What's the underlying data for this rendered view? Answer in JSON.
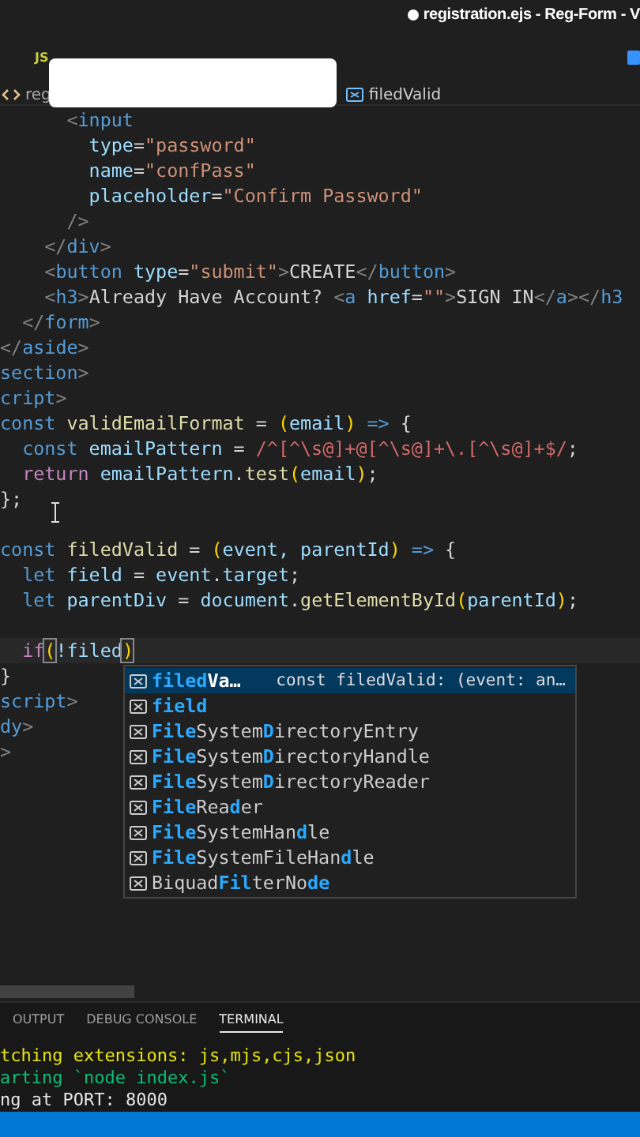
{
  "window": {
    "title": "registration.ejs - Reg-Form - V",
    "unsaved": true
  },
  "tab_bar": {
    "file_icon": "JS"
  },
  "breadcrumb": {
    "start": "reg",
    "symbol": "filedValid"
  },
  "editor": {
    "lines": [
      {
        "tokens": [
          {
            "text": "      <",
            "kind": "p"
          },
          {
            "text": "input",
            "kind": "tag"
          }
        ]
      },
      {
        "tokens": [
          {
            "text": "        type",
            "kind": "attr"
          },
          {
            "text": "=",
            "kind": "txt"
          },
          {
            "text": "\"password\"",
            "kind": "str"
          }
        ]
      },
      {
        "tokens": [
          {
            "text": "        name",
            "kind": "attr"
          },
          {
            "text": "=",
            "kind": "txt"
          },
          {
            "text": "\"confPass\"",
            "kind": "str"
          }
        ]
      },
      {
        "tokens": [
          {
            "text": "        placeholder",
            "kind": "attr"
          },
          {
            "text": "=",
            "kind": "txt"
          },
          {
            "text": "\"Confirm Password\"",
            "kind": "str"
          }
        ]
      },
      {
        "tokens": [
          {
            "text": "      />",
            "kind": "p"
          }
        ]
      },
      {
        "tokens": [
          {
            "text": "    </",
            "kind": "p"
          },
          {
            "text": "div",
            "kind": "tag"
          },
          {
            "text": ">",
            "kind": "p"
          }
        ]
      },
      {
        "tokens": [
          {
            "text": "    <",
            "kind": "p"
          },
          {
            "text": "button",
            "kind": "tag"
          },
          {
            "text": " type",
            "kind": "attr"
          },
          {
            "text": "=",
            "kind": "txt"
          },
          {
            "text": "\"submit\"",
            "kind": "str"
          },
          {
            "text": ">",
            "kind": "p"
          },
          {
            "text": "CREATE",
            "kind": "txt"
          },
          {
            "text": "</",
            "kind": "p"
          },
          {
            "text": "button",
            "kind": "tag"
          },
          {
            "text": ">",
            "kind": "p"
          }
        ]
      },
      {
        "tokens": [
          {
            "text": "    <",
            "kind": "p"
          },
          {
            "text": "h3",
            "kind": "tag"
          },
          {
            "text": ">",
            "kind": "p"
          },
          {
            "text": "Already Have Account? ",
            "kind": "txt"
          },
          {
            "text": "<",
            "kind": "p"
          },
          {
            "text": "a",
            "kind": "tag"
          },
          {
            "text": " href",
            "kind": "attr"
          },
          {
            "text": "=",
            "kind": "txt"
          },
          {
            "text": "\"\"",
            "kind": "str"
          },
          {
            "text": ">",
            "kind": "p"
          },
          {
            "text": "SIGN IN",
            "kind": "txt"
          },
          {
            "text": "</",
            "kind": "p"
          },
          {
            "text": "a",
            "kind": "tag"
          },
          {
            "text": "></",
            "kind": "p"
          },
          {
            "text": "h3",
            "kind": "tag"
          }
        ]
      },
      {
        "tokens": [
          {
            "text": "  </",
            "kind": "p"
          },
          {
            "text": "form",
            "kind": "tag"
          },
          {
            "text": ">",
            "kind": "p"
          }
        ]
      },
      {
        "tokens": [
          {
            "text": "</",
            "kind": "p"
          },
          {
            "text": "aside",
            "kind": "tag"
          },
          {
            "text": ">",
            "kind": "p"
          }
        ]
      },
      {
        "tokens": [
          {
            "text": "section",
            "kind": "tag"
          },
          {
            "text": ">",
            "kind": "p"
          }
        ]
      },
      {
        "tokens": [
          {
            "text": "cript",
            "kind": "tag"
          },
          {
            "text": ">",
            "kind": "p"
          }
        ]
      },
      {
        "tokens": [
          {
            "text": "const ",
            "kind": "kw"
          },
          {
            "text": "validEmailFormat",
            "kind": "fn"
          },
          {
            "text": " = ",
            "kind": "txt"
          },
          {
            "text": "(",
            "kind": "br"
          },
          {
            "text": "email",
            "kind": "var"
          },
          {
            "text": ")",
            "kind": "br"
          },
          {
            "text": " => ",
            "kind": "kw"
          },
          {
            "text": "{",
            "kind": "txt"
          }
        ]
      },
      {
        "tokens": [
          {
            "text": "  const ",
            "kind": "kw"
          },
          {
            "text": "emailPattern",
            "kind": "var"
          },
          {
            "text": " = ",
            "kind": "txt"
          },
          {
            "text": "/^[^\\s@]+@[^\\s@]+\\.[^\\s@]+$/",
            "kind": "re"
          },
          {
            "text": ";",
            "kind": "txt"
          }
        ]
      },
      {
        "tokens": [
          {
            "text": "  return ",
            "kind": "ctl"
          },
          {
            "text": "emailPattern",
            "kind": "var"
          },
          {
            "text": ".",
            "kind": "txt"
          },
          {
            "text": "test",
            "kind": "fn"
          },
          {
            "text": "(",
            "kind": "br"
          },
          {
            "text": "email",
            "kind": "var"
          },
          {
            "text": ")",
            "kind": "br"
          },
          {
            "text": ";",
            "kind": "txt"
          }
        ]
      },
      {
        "tokens": [
          {
            "text": "};",
            "kind": "txt"
          }
        ]
      },
      {
        "blank_before": true,
        "tokens": [
          {
            "text": "const ",
            "kind": "kw"
          },
          {
            "text": "filedValid",
            "kind": "fn"
          },
          {
            "text": " = ",
            "kind": "txt"
          },
          {
            "text": "(",
            "kind": "br"
          },
          {
            "text": "event, parentId",
            "kind": "var"
          },
          {
            "text": ")",
            "kind": "br"
          },
          {
            "text": " => ",
            "kind": "kw"
          },
          {
            "text": "{",
            "kind": "txt"
          }
        ]
      },
      {
        "tokens": [
          {
            "text": "  let ",
            "kind": "kw"
          },
          {
            "text": "field",
            "kind": "var"
          },
          {
            "text": " = ",
            "kind": "txt"
          },
          {
            "text": "event",
            "kind": "var"
          },
          {
            "text": ".",
            "kind": "txt"
          },
          {
            "text": "target",
            "kind": "var"
          },
          {
            "text": ";",
            "kind": "txt"
          }
        ]
      },
      {
        "tokens": [
          {
            "text": "  let ",
            "kind": "kw"
          },
          {
            "text": "parentDiv",
            "kind": "var"
          },
          {
            "text": " = ",
            "kind": "txt"
          },
          {
            "text": "document",
            "kind": "var"
          },
          {
            "text": ".",
            "kind": "txt"
          },
          {
            "text": "getElementById",
            "kind": "fn"
          },
          {
            "text": "(",
            "kind": "br"
          },
          {
            "text": "parentId",
            "kind": "var"
          },
          {
            "text": ")",
            "kind": "br"
          },
          {
            "text": ";",
            "kind": "txt"
          }
        ]
      },
      {
        "blank_before": true,
        "current": true,
        "tokens": [
          {
            "text": "  if",
            "kind": "ctl"
          },
          {
            "text": "(",
            "kind": "brm"
          },
          {
            "text": "!filed",
            "kind": "var"
          },
          {
            "text": ")",
            "kind": "brm"
          }
        ]
      },
      {
        "tokens": [
          {
            "text": "}",
            "kind": "txt"
          }
        ]
      },
      {
        "tokens": [
          {
            "text": "script",
            "kind": "tag"
          },
          {
            "text": ">",
            "kind": "p"
          }
        ]
      },
      {
        "tokens": [
          {
            "text": "dy",
            "kind": "tag"
          },
          {
            "text": ">",
            "kind": "p"
          }
        ]
      },
      {
        "tokens": [
          {
            "text": ">",
            "kind": "p"
          }
        ]
      }
    ]
  },
  "suggestions": [
    {
      "label": "**filed**Va…",
      "detail": "const filedValid: (event: an…",
      "selected": true
    },
    {
      "label": "**field**",
      "selected": false
    },
    {
      "label": "**File**System**D**irectoryEntry",
      "selected": false
    },
    {
      "label": "**File**System**D**irectoryHandle",
      "selected": false
    },
    {
      "label": "**File**System**D**irectoryReader",
      "selected": false
    },
    {
      "label": "**File**Rea**d**er",
      "selected": false
    },
    {
      "label": "**File**SystemHan**d**le",
      "selected": false
    },
    {
      "label": "**File**SystemFileHan**d**le",
      "selected": false
    },
    {
      "label": "Biquad**Fil**terNo**de**",
      "selected": false
    }
  ],
  "panel": {
    "tabs": [
      {
        "label": "OUTPUT",
        "selected": false
      },
      {
        "label": "DEBUG CONSOLE",
        "selected": false
      },
      {
        "label": "TERMINAL",
        "selected": true
      }
    ],
    "terminal": [
      {
        "text": "tching extensions: js,mjs,cjs,json",
        "color": "#e5e510"
      },
      {
        "text": "arting `node index.js`",
        "color": "#0dbc79"
      },
      {
        "text": "ng at PORT: 8000",
        "color": "#e5e5e5"
      }
    ]
  }
}
